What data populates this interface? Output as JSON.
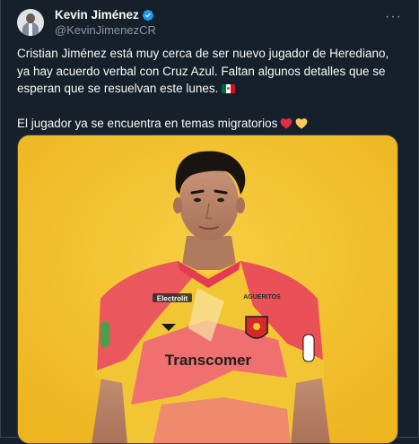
{
  "author": {
    "display_name": "Kevin Jiménez",
    "handle": "@KevinJimenezCR",
    "verified": true,
    "avatar_icon": "user-avatar"
  },
  "menu": {
    "more_label": "···"
  },
  "tweet": {
    "paragraph1": "Cristian Jiménez está muy cerca de ser nuevo jugador de Herediano, ya hay acuerdo verbal con Cruz Azul. Faltan algunos detalles que se esperan que se resuelvan este lunes.",
    "paragraph1_emoji": "mexico-flag",
    "paragraph2": "El jugador ya se encuentra en temas migratorios",
    "paragraph2_emojis": [
      "red-heart",
      "yellow-heart"
    ]
  },
  "media": {
    "background_color": "#f2c233",
    "jersey_sponsor": "Electrolit",
    "jersey_main_sponsor": "Transcomer",
    "jersey_chest_right": "AGUERITOS"
  },
  "colors": {
    "background": "#15202b",
    "text": "#f7f9f9",
    "secondary": "#8b98a5",
    "verified": "#1d9bf0",
    "border": "#38444d"
  }
}
